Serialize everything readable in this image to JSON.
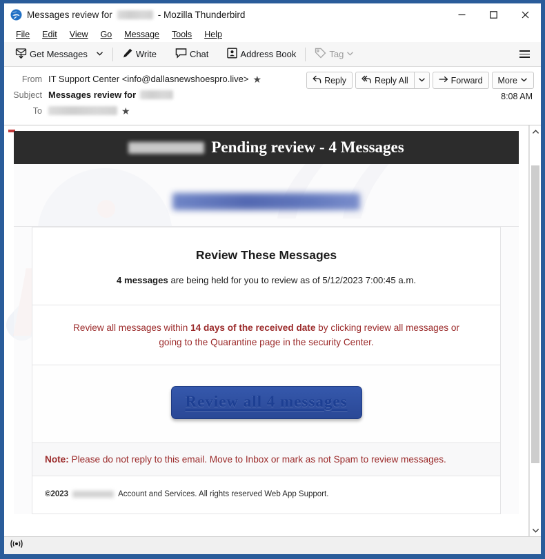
{
  "window": {
    "title_prefix": "Messages review for",
    "title_suffix": "- Mozilla Thunderbird",
    "app_icon": "thunderbird-icon",
    "minimize_label": "–",
    "maximize_label": "□",
    "close_label": "✕"
  },
  "menubar": {
    "items": [
      {
        "label": "File",
        "accel": "F"
      },
      {
        "label": "Edit",
        "accel": "E"
      },
      {
        "label": "View",
        "accel": "V"
      },
      {
        "label": "Go",
        "accel": "G"
      },
      {
        "label": "Message",
        "accel": "M"
      },
      {
        "label": "Tools",
        "accel": "T"
      },
      {
        "label": "Help",
        "accel": "H"
      }
    ]
  },
  "toolbar": {
    "get_messages": "Get Messages",
    "write": "Write",
    "chat": "Chat",
    "address_book": "Address Book",
    "tag": "Tag",
    "app_menu_icon": "hamburger-icon"
  },
  "message_header": {
    "from_label": "From",
    "from_value": "IT Support Center <info@dallasnewshoespro.live>",
    "subject_label": "Subject",
    "subject_value": "Messages review for",
    "subject_redacted": true,
    "to_label": "To",
    "to_redacted": true,
    "time": "8:08 AM",
    "star_icon": "star-icon",
    "actions": {
      "reply": "Reply",
      "reply_all": "Reply All",
      "reply_all_more_icon": "chevron-down-icon",
      "forward": "Forward",
      "more": "More",
      "more_icon": "chevron-down-icon"
    }
  },
  "email": {
    "banner": {
      "redacted_domain": true,
      "title": "Pending review - 4 Messages"
    },
    "logo_redacted": true,
    "heading": "Review These Messages",
    "summary_bold": "4 messages",
    "summary_rest": " are being held for you to review as of 5/12/2023 7:00:45 a.m.",
    "warning_part1": "Review all messages within ",
    "warning_bold": "14 days of the received date",
    "warning_part2": " by clicking review all messages or going to the Quarantine page in the security Center.",
    "cta_label": "Review all 4 messages",
    "note_bold": "Note:",
    "note_text": " Please do not reply to this email. Move to Inbox or mark as not Spam to review messages.",
    "copyright_symbol": "©2023",
    "copyright_redacted": true,
    "copyright_rest": "Account and Services. All rights reserved Web App Support.",
    "watermark_text": "risk",
    "watermark_text2": "77"
  },
  "scrollbar": {
    "up_icon": "chevron-up-icon",
    "down_icon": "chevron-down-icon"
  },
  "statusbar": {
    "icon": "broadcast-icon"
  },
  "colors": {
    "window_frame": "#2a5c9a",
    "banner_bg": "#2c2c2c",
    "warning_red": "#9b2a2a",
    "cta_blue": "#2f4fa0",
    "cta_text_blue": "#1d3f93"
  }
}
